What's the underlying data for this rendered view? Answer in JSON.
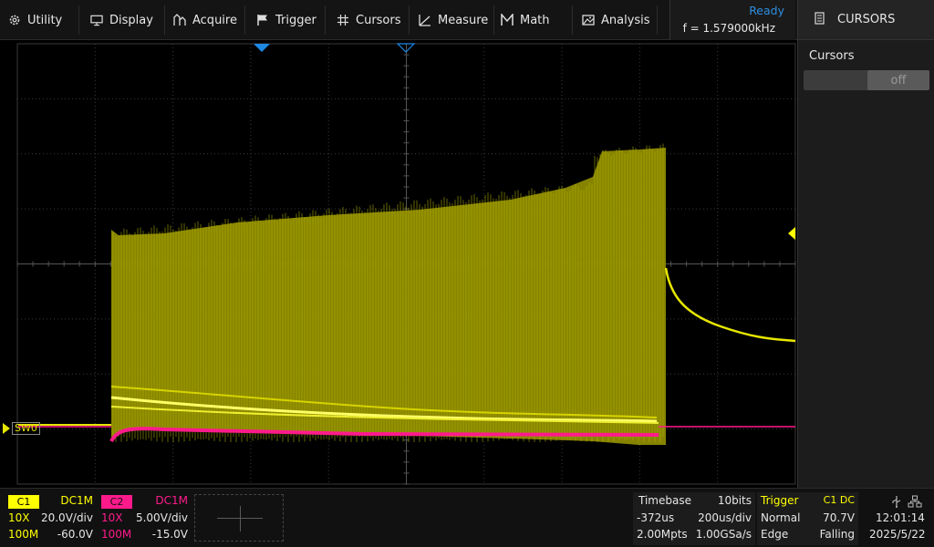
{
  "menu": {
    "items": [
      {
        "id": "utility",
        "label": "Utility",
        "icon": "gear-icon"
      },
      {
        "id": "display",
        "label": "Display",
        "icon": "monitor-icon"
      },
      {
        "id": "acquire",
        "label": "Acquire",
        "icon": "acquire-icon"
      },
      {
        "id": "trigger",
        "label": "Trigger",
        "icon": "flag-icon"
      },
      {
        "id": "cursors",
        "label": "Cursors",
        "icon": "crosshair-icon"
      },
      {
        "id": "measure",
        "label": "Measure",
        "icon": "ruler-icon"
      },
      {
        "id": "math",
        "label": "Math",
        "icon": "math-icon"
      },
      {
        "id": "analysis",
        "label": "Analysis",
        "icon": "image-analysis-icon"
      }
    ]
  },
  "status": {
    "state": "Ready",
    "frequency": "f = 1.579000kHz"
  },
  "panel": {
    "title": "CURSORS",
    "icon": "document-icon",
    "section": "Cursors",
    "toggle": "off"
  },
  "scope": {
    "channel_label": "SW0",
    "trace_color": "#e6e600",
    "ch2_color": "#ff1a8c"
  },
  "channels": {
    "c1": {
      "tag": "C1",
      "coupling": "DC1M",
      "probe": "10X",
      "scale": "20.0V/div",
      "bw": "100M",
      "offset": "-60.0V",
      "color": "#ffff00"
    },
    "c2": {
      "tag": "C2",
      "coupling": "DC1M",
      "probe": "10X",
      "scale": "5.00V/div",
      "bw": "100M",
      "offset": "-15.0V",
      "color": "#ff1a8c"
    }
  },
  "timebase": {
    "label": "Timebase",
    "bits": "10bits",
    "delay": "-372us",
    "scale": "200us/div",
    "memory": "2.00Mpts",
    "rate": "1.00GSa/s"
  },
  "trigger": {
    "label": "Trigger",
    "source": "C1 DC",
    "mode": "Normal",
    "level": "70.7V",
    "type": "Edge",
    "slope": "Falling"
  },
  "clock": {
    "time": "12:01:14",
    "date": "2025/5/22"
  }
}
